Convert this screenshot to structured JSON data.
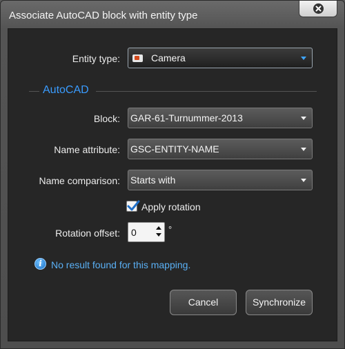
{
  "window": {
    "title": "Associate AutoCAD block with entity type",
    "close_icon": "close-icon"
  },
  "entity_type": {
    "label": "Entity type:",
    "value": "Camera",
    "icon": "camera-icon"
  },
  "section": {
    "title": "AutoCAD"
  },
  "block": {
    "label": "Block:",
    "value": "GAR-61-Turnummer-2013"
  },
  "name_attribute": {
    "label": "Name attribute:",
    "value": "GSC-ENTITY-NAME"
  },
  "name_comparison": {
    "label": "Name comparison:",
    "value": "Starts with"
  },
  "apply_rotation": {
    "label": "Apply rotation",
    "checked": true
  },
  "rotation_offset": {
    "label": "Rotation offset:",
    "value": "0",
    "unit": "°"
  },
  "info": {
    "icon": "info-icon",
    "message": "No result found for this mapping."
  },
  "buttons": {
    "cancel": "Cancel",
    "synchronize": "Synchronize"
  },
  "colors": {
    "accent": "#3a9cff",
    "panel": "#262626",
    "info_text": "#5ab0f5"
  }
}
